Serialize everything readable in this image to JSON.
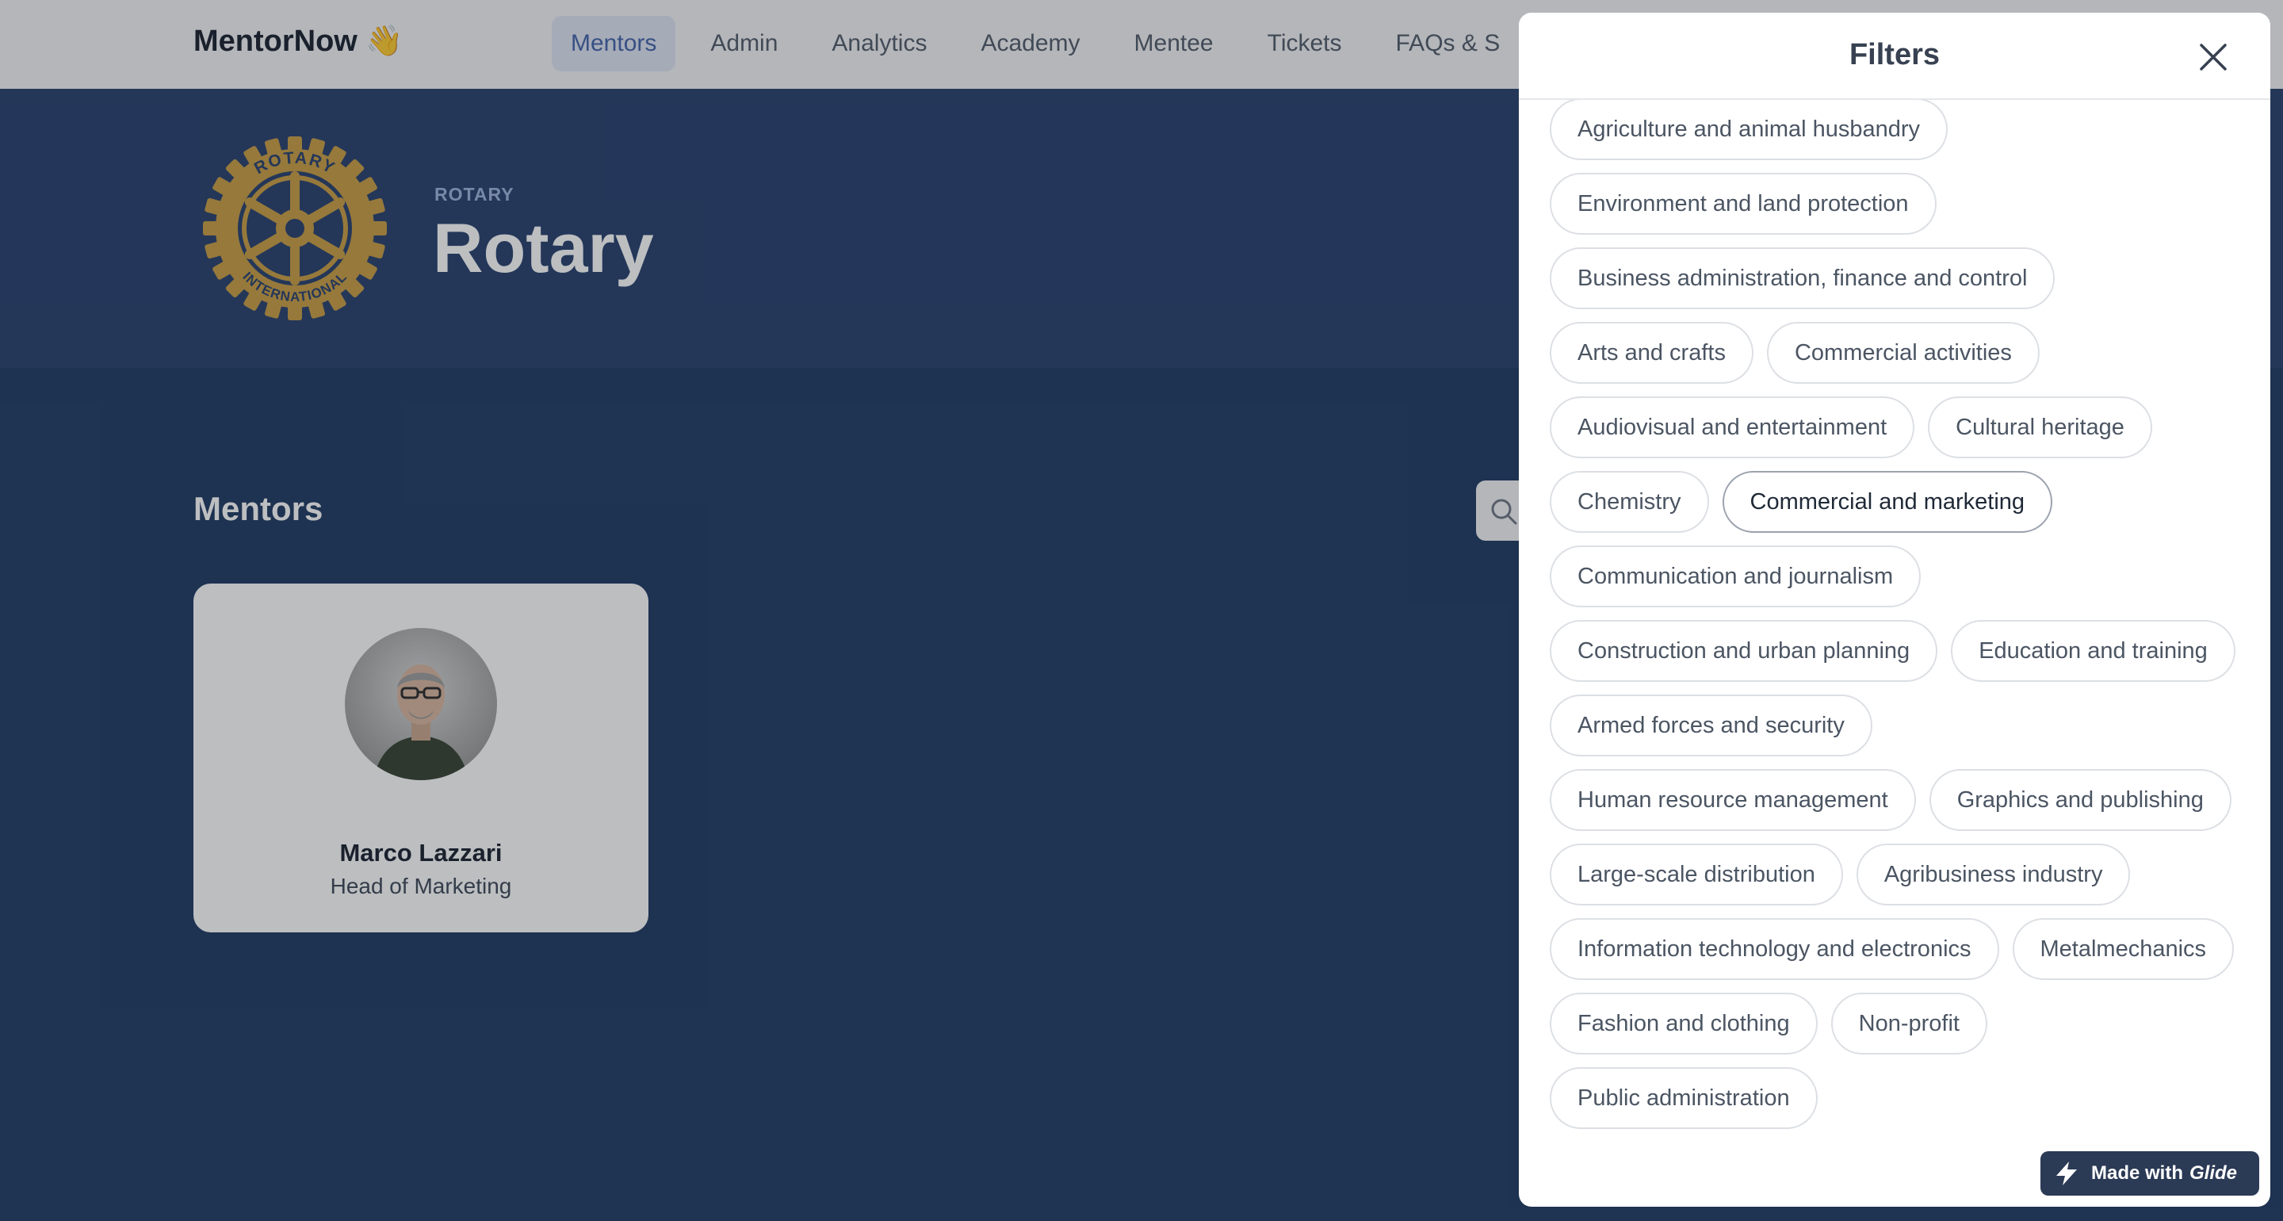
{
  "app": {
    "brand": "MentorNow 👋"
  },
  "nav": {
    "items": [
      "Mentors",
      "Admin",
      "Analytics",
      "Academy",
      "Mentee",
      "Tickets",
      "FAQs & S"
    ],
    "active": "Mentors"
  },
  "org": {
    "eyebrow": "ROTARY",
    "name": "Rotary",
    "logo_text_top": "ROTARY",
    "logo_text_bottom": "INTERNATIONAL",
    "logo_color": "#c89a3c"
  },
  "main": {
    "section_title": "Mentors"
  },
  "mentor": {
    "name": "Marco Lazzari",
    "role": "Head of Marketing"
  },
  "filters": {
    "title": "Filters",
    "chips": [
      {
        "label": "Agriculture and animal husbandry"
      },
      {
        "label": "Environment and land protection"
      },
      {
        "label": "Business administration, finance and control"
      },
      {
        "label": "Arts and crafts"
      },
      {
        "label": "Commercial activities"
      },
      {
        "label": "Audiovisual and entertainment"
      },
      {
        "label": "Cultural heritage"
      },
      {
        "label": "Chemistry"
      },
      {
        "label": "Commercial and marketing",
        "selected": true
      },
      {
        "label": "Communication and journalism"
      },
      {
        "label": "Construction and urban planning"
      },
      {
        "label": "Education and training"
      },
      {
        "label": "Armed forces and security"
      },
      {
        "label": "Human resource management"
      },
      {
        "label": "Graphics and publishing"
      },
      {
        "label": "Large-scale distribution"
      },
      {
        "label": "Agribusiness industry"
      },
      {
        "label": "Information technology and electronics"
      },
      {
        "label": "Metalmechanics"
      },
      {
        "label": "Fashion and clothing"
      },
      {
        "label": "Non-profit"
      },
      {
        "label": "Public administration"
      }
    ]
  },
  "badge": {
    "prefix": "Made with",
    "brand": "Glide"
  },
  "colors": {
    "accent": "#3b5da6",
    "hero": "#1f3868",
    "page": "#17325c"
  }
}
